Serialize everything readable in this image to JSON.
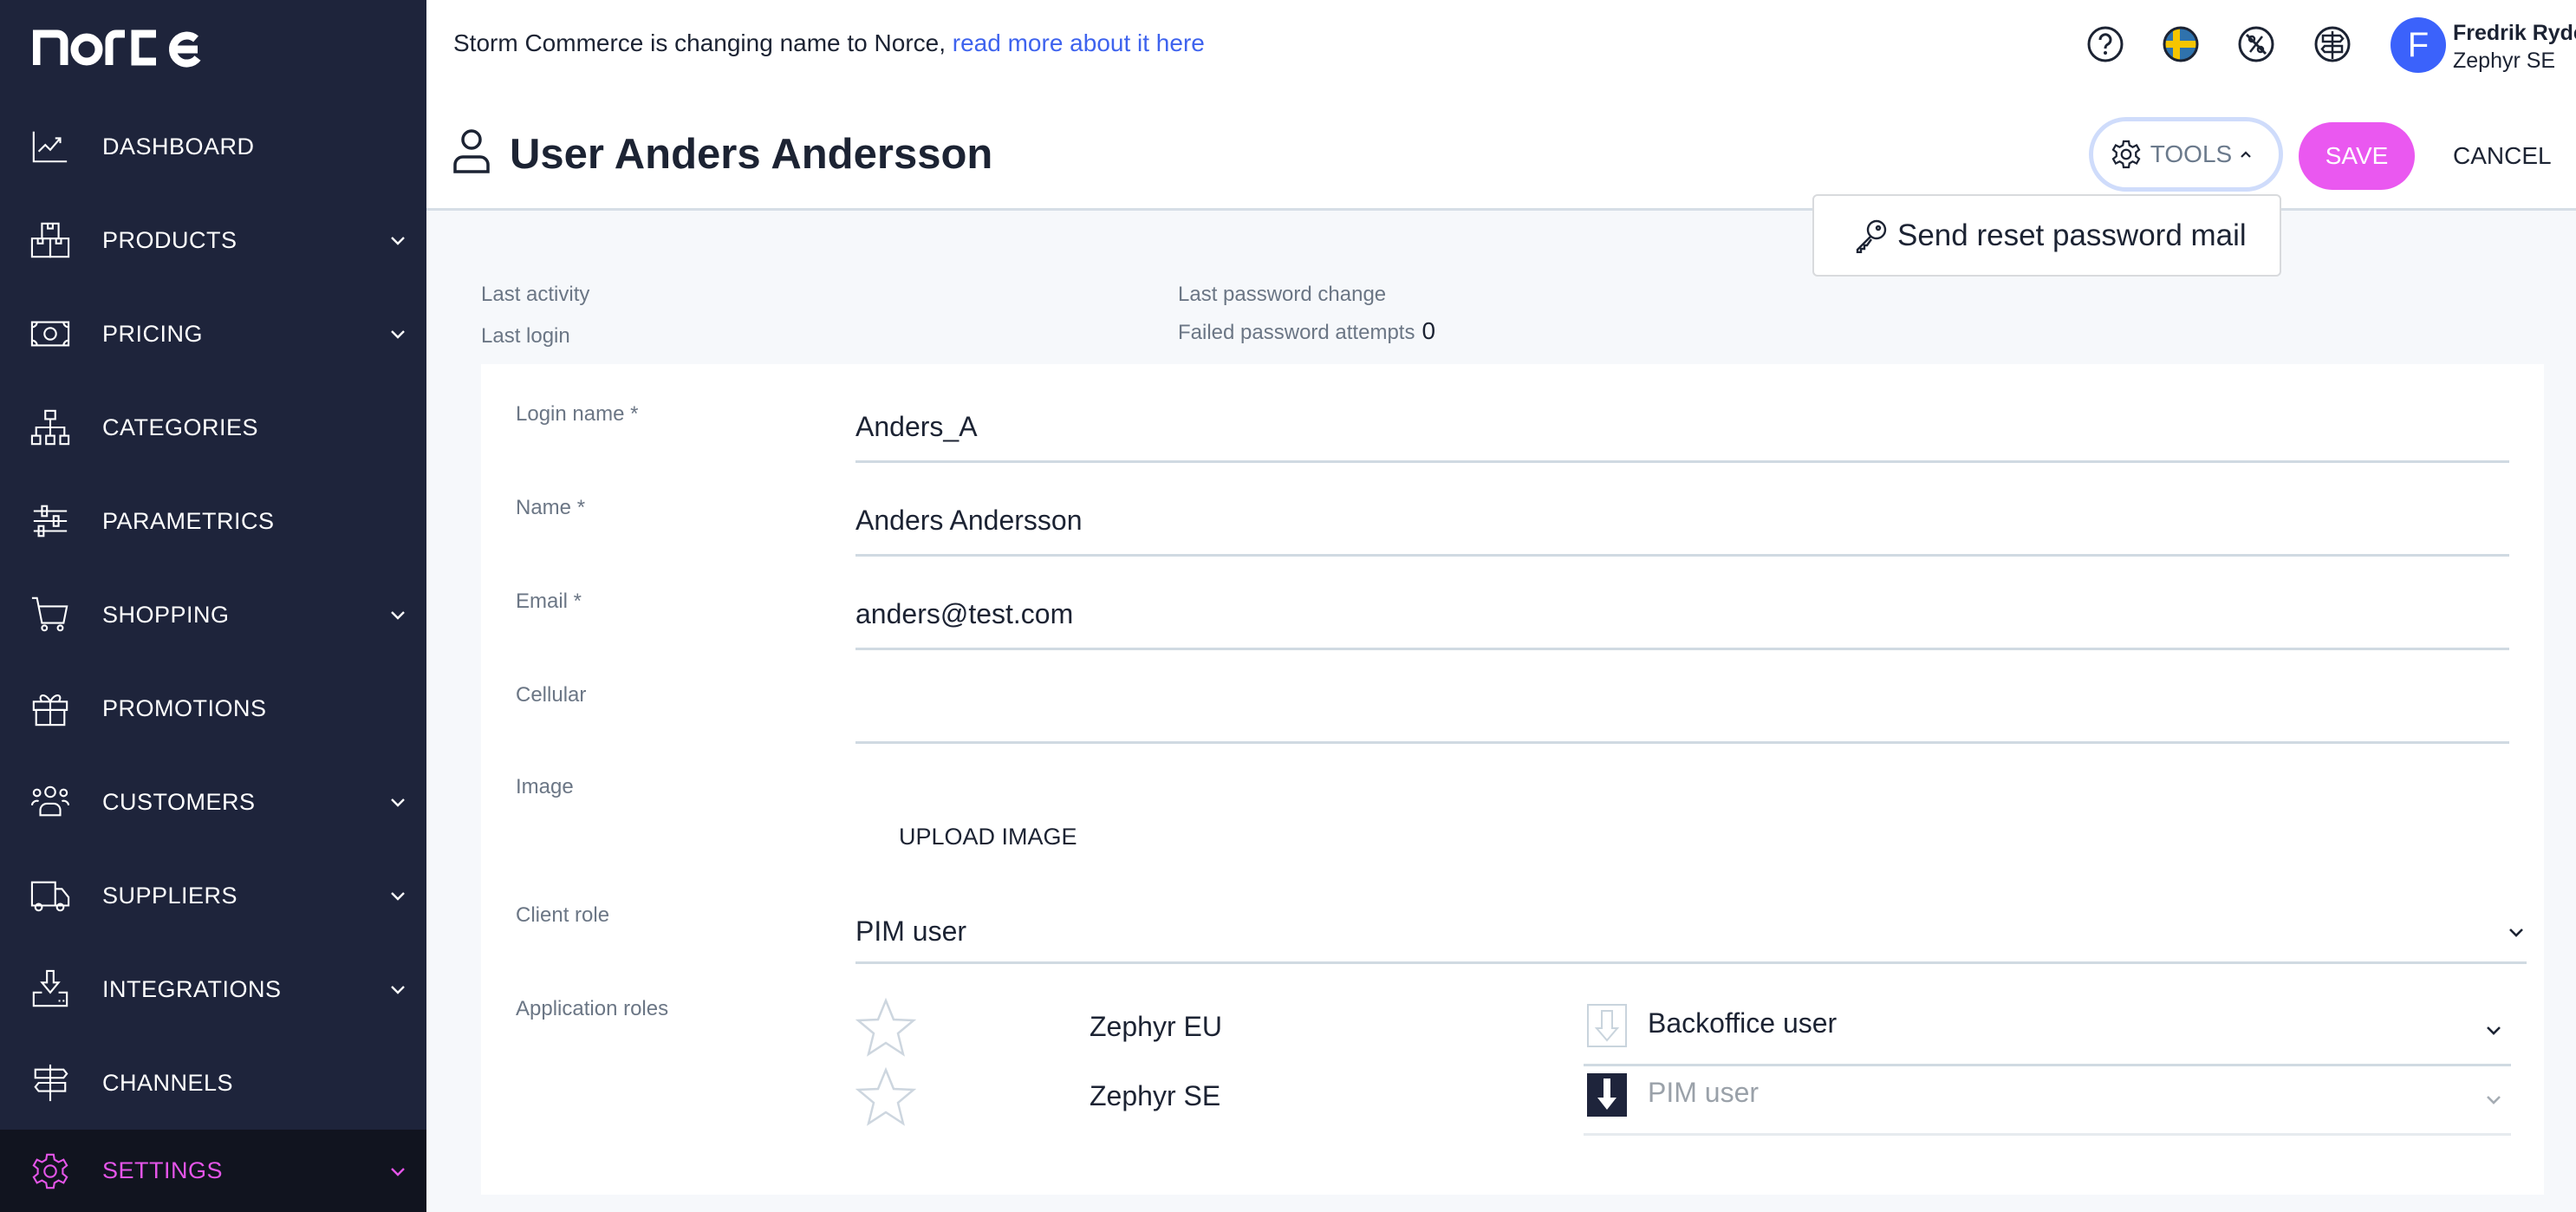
{
  "app": {
    "logo": "norce"
  },
  "sidebar": {
    "items": [
      {
        "label": "DASHBOARD",
        "icon": "chart-icon",
        "expandable": false
      },
      {
        "label": "PRODUCTS",
        "icon": "boxes-icon",
        "expandable": true
      },
      {
        "label": "PRICING",
        "icon": "banknote-icon",
        "expandable": true
      },
      {
        "label": "CATEGORIES",
        "icon": "hierarchy-icon",
        "expandable": false
      },
      {
        "label": "PARAMETRICS",
        "icon": "sliders-icon",
        "expandable": false
      },
      {
        "label": "SHOPPING",
        "icon": "cart-icon",
        "expandable": true
      },
      {
        "label": "PROMOTIONS",
        "icon": "gift-icon",
        "expandable": false
      },
      {
        "label": "CUSTOMERS",
        "icon": "users-icon",
        "expandable": true
      },
      {
        "label": "SUPPLIERS",
        "icon": "truck-icon",
        "expandable": true
      },
      {
        "label": "INTEGRATIONS",
        "icon": "download-tray-icon",
        "expandable": true
      },
      {
        "label": "CHANNELS",
        "icon": "signpost-icon",
        "expandable": false
      },
      {
        "label": "SETTINGS",
        "icon": "gear-icon",
        "expandable": true,
        "active": true
      }
    ]
  },
  "header": {
    "banner_text": "Storm Commerce is changing name to Norce, ",
    "banner_link": "read more about it here",
    "user": {
      "initial": "F",
      "name": "Fredrik Ryde",
      "org": "Zephyr SE"
    },
    "icons": [
      "help-icon",
      "sweden-flag-icon",
      "no-discount-icon",
      "signpost-icon"
    ]
  },
  "page": {
    "title": "User Anders Andersson",
    "tools_label": "TOOLS",
    "save_label": "SAVE",
    "cancel_label": "CANCEL",
    "tools_menu": [
      {
        "label": "Send reset password mail",
        "icon": "key-icon"
      }
    ]
  },
  "meta": {
    "last_activity_label": "Last activity",
    "last_activity_value": "",
    "last_login_label": "Last login",
    "last_login_value": "",
    "last_password_change_label": "Last password change",
    "last_password_change_value": "",
    "failed_attempts_label": "Failed password attempts",
    "failed_attempts_value": "0"
  },
  "form": {
    "login_name": {
      "label": "Login name *",
      "value": "Anders_A"
    },
    "name": {
      "label": "Name *",
      "value": "Anders Andersson"
    },
    "email": {
      "label": "Email *",
      "value": "anders@test.com"
    },
    "cellular": {
      "label": "Cellular",
      "value": ""
    },
    "image": {
      "label": "Image",
      "upload_label": "UPLOAD IMAGE"
    },
    "client_role": {
      "label": "Client role",
      "value": "PIM user"
    },
    "application_roles": {
      "label": "Application roles",
      "rows": [
        {
          "application": "Zephyr EU",
          "role": "Backoffice user",
          "inherited": false,
          "disabled": false
        },
        {
          "application": "Zephyr SE",
          "role": "PIM user",
          "inherited": true,
          "disabled": true
        }
      ]
    }
  },
  "colors": {
    "sidebar_bg": "#1e243b",
    "active_accent": "#e455e8",
    "save_button": "#ea58f0",
    "link": "#3e63ee",
    "avatar": "#3b62fb"
  }
}
